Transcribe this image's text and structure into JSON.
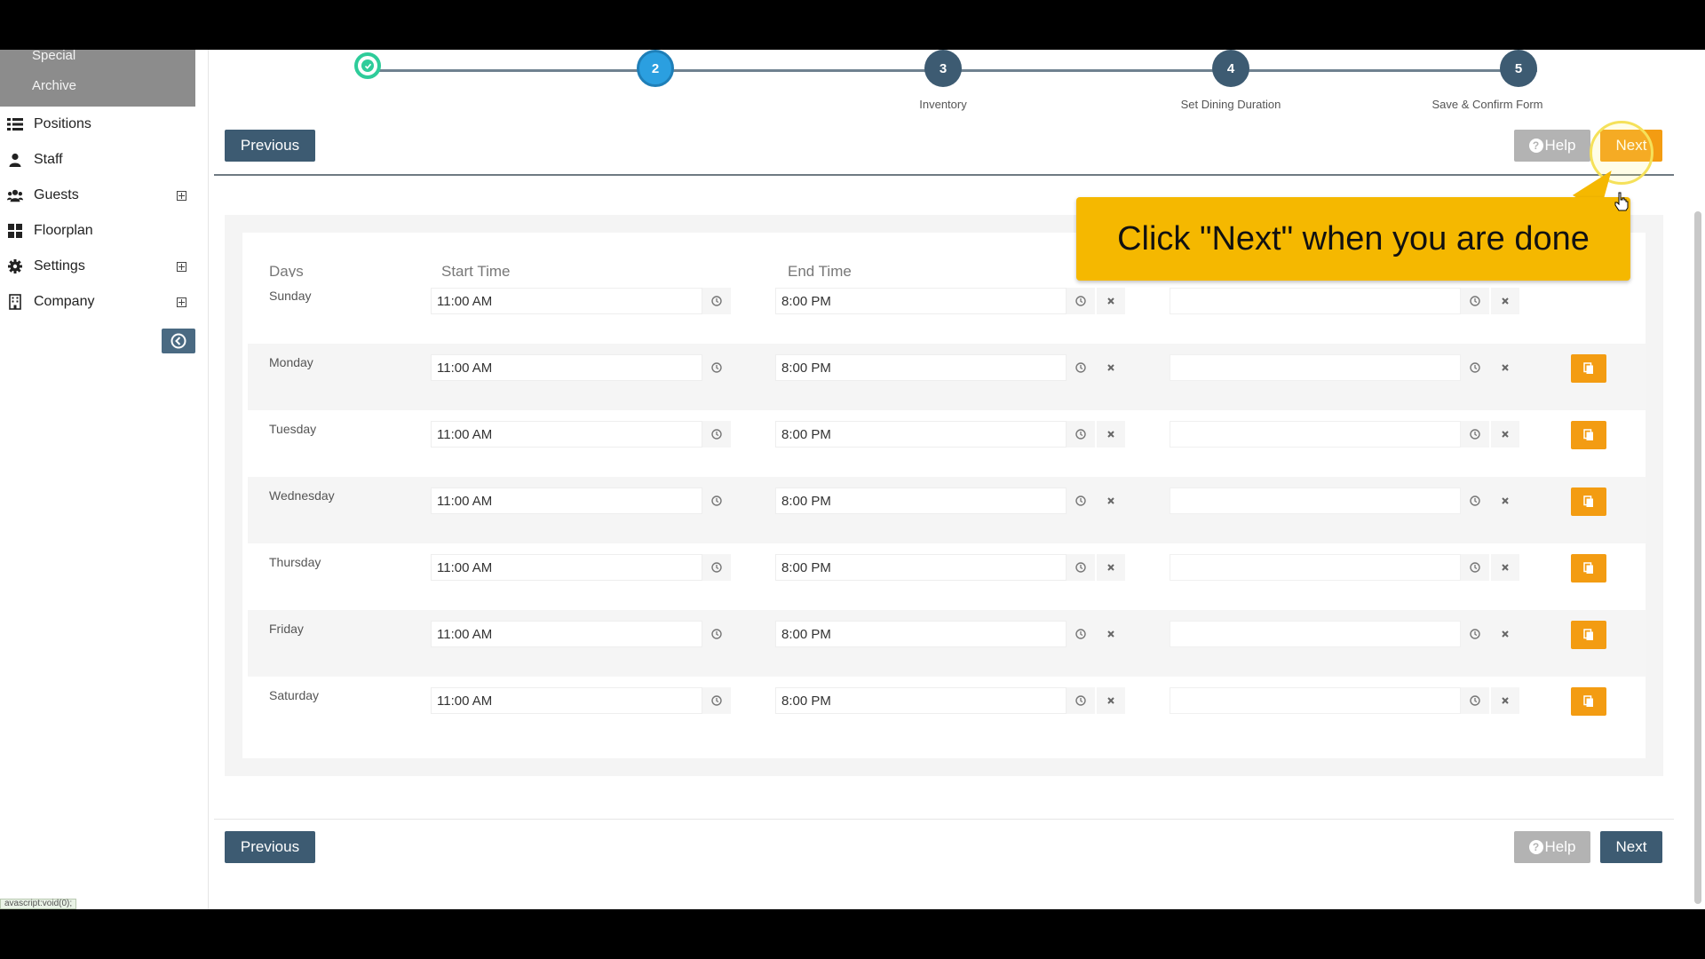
{
  "sidebar": {
    "submenu": [
      "Special",
      "Archive"
    ],
    "items": [
      {
        "label": "Positions",
        "icon": "list-icon",
        "expandable": false
      },
      {
        "label": "Staff",
        "icon": "user-icon",
        "expandable": false
      },
      {
        "label": "Guests",
        "icon": "users-icon",
        "expandable": true
      },
      {
        "label": "Floorplan",
        "icon": "grid-icon",
        "expandable": false
      },
      {
        "label": "Settings",
        "icon": "gear-icon",
        "expandable": true
      },
      {
        "label": "Company",
        "icon": "building-icon",
        "expandable": true
      }
    ]
  },
  "status_url": "avascript:void(0);",
  "wizard": {
    "steps": [
      {
        "number": "",
        "label": "",
        "state": "done"
      },
      {
        "number": "2",
        "label": "",
        "state": "active"
      },
      {
        "number": "3",
        "label": "Inventory",
        "state": "pending"
      },
      {
        "number": "4",
        "label": "Set Dining Duration",
        "state": "pending"
      },
      {
        "number": "5",
        "label": "Save & Confirm Form",
        "state": "pending"
      }
    ]
  },
  "buttons": {
    "previous": "Previous",
    "help": "Help",
    "next": "Next"
  },
  "table": {
    "headers": {
      "days": "Days",
      "start": "Start Time",
      "end": "End Time"
    },
    "rows": [
      {
        "day": "Sunday",
        "start": "11:00 AM",
        "end": "8:00 PM",
        "extra": "",
        "copy": false
      },
      {
        "day": "Monday",
        "start": "11:00 AM",
        "end": "8:00 PM",
        "extra": "",
        "copy": true
      },
      {
        "day": "Tuesday",
        "start": "11:00 AM",
        "end": "8:00 PM",
        "extra": "",
        "copy": true
      },
      {
        "day": "Wednesday",
        "start": "11:00 AM",
        "end": "8:00 PM",
        "extra": "",
        "copy": true
      },
      {
        "day": "Thursday",
        "start": "11:00 AM",
        "end": "8:00 PM",
        "extra": "",
        "copy": true
      },
      {
        "day": "Friday",
        "start": "11:00 AM",
        "end": "8:00 PM",
        "extra": "",
        "copy": true
      },
      {
        "day": "Saturday",
        "start": "11:00 AM",
        "end": "8:00 PM",
        "extra": "",
        "copy": true
      }
    ]
  },
  "callout": {
    "text": "Click \"Next\" when you are done"
  },
  "colors": {
    "primary": "#3d5b72",
    "accent": "#f39c12",
    "callout": "#f5b800",
    "done": "#2ecc9a",
    "active": "#2b9fe0"
  }
}
